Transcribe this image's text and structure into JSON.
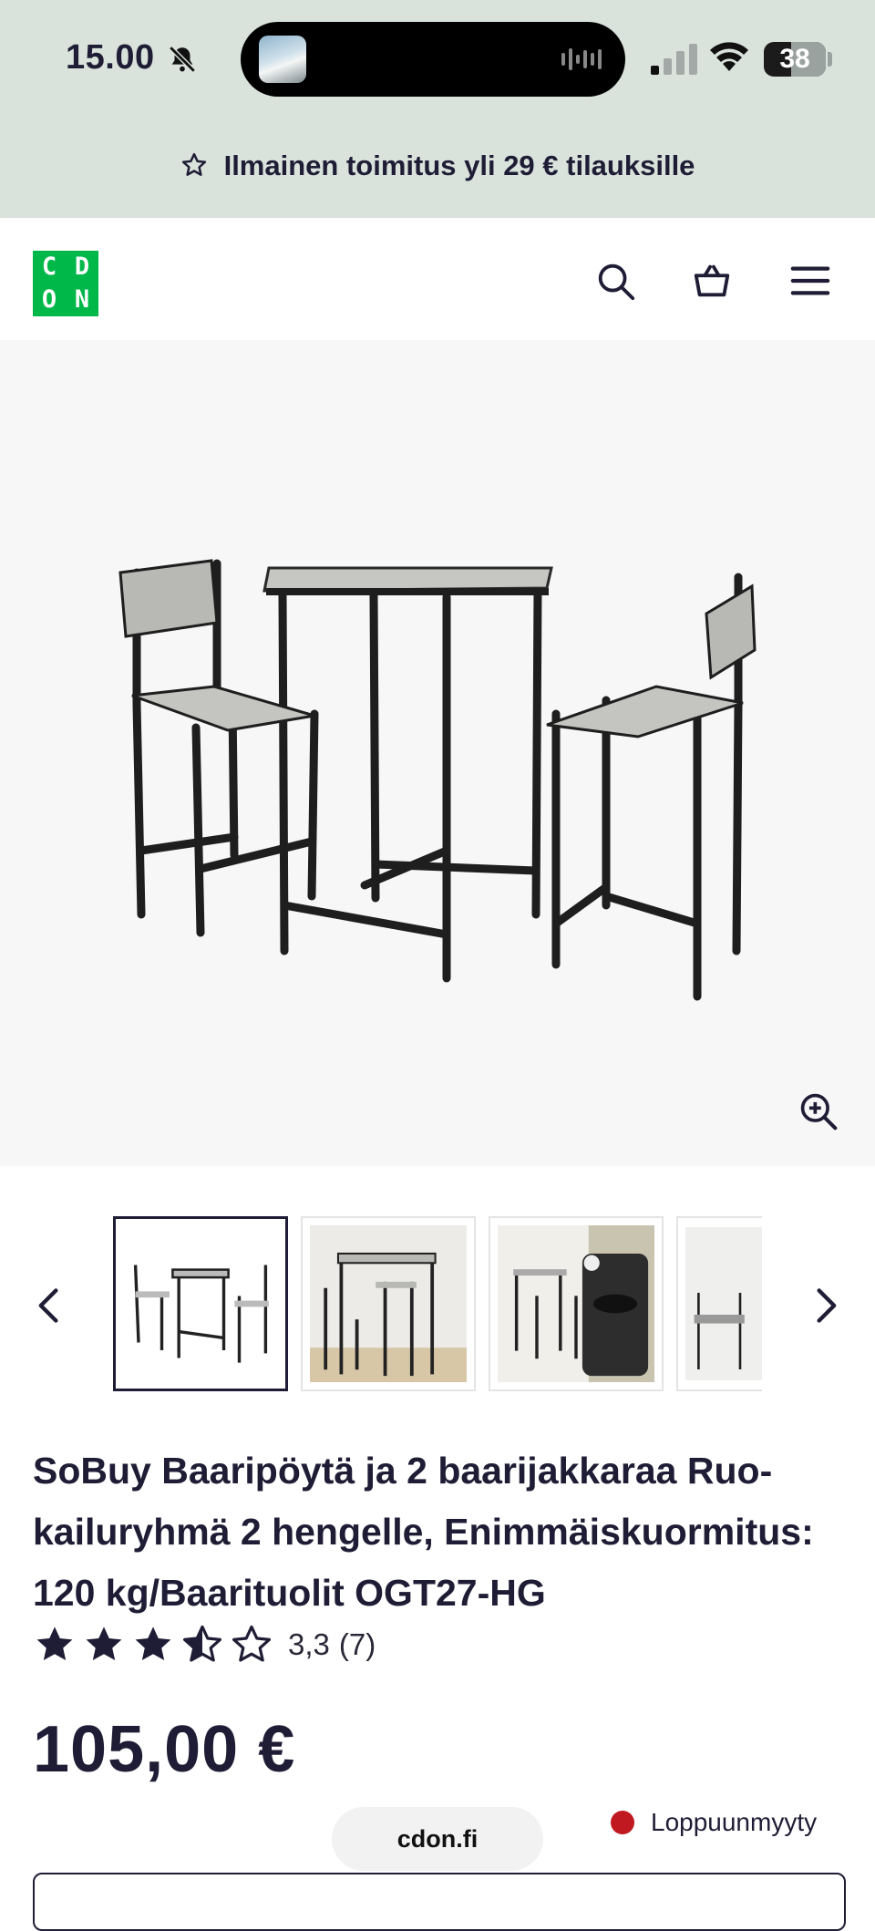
{
  "status_bar": {
    "time": "15.00",
    "battery": "38"
  },
  "promo": {
    "text": "Ilmainen toimitus yli 29 € tilauksille"
  },
  "header": {
    "logo_letters": [
      "C",
      "D",
      "O",
      "N"
    ],
    "icons": [
      "search-icon",
      "basket-icon",
      "menu-icon"
    ]
  },
  "gallery": {
    "zoom_icon": "zoom-in-icon"
  },
  "thumbnails": {
    "count_visible": 4,
    "active_index": 0
  },
  "product": {
    "title": "SoBuy Baaripöytä ja 2 baarijakkaraa Ruo­kailuryhmä 2 hengelle, Enimmäiskuormi­tus: 120 kg/Baarituolit OGT27-HG",
    "rating_value": "3,3",
    "rating_count": "(7)",
    "rating_stars": 3.5,
    "price": "105,00 €",
    "stock_status": "Loppuunmyyty",
    "stock_color": "#c0191f"
  },
  "browser": {
    "url": "cdon.fi"
  },
  "colors": {
    "brand": "#00b74a",
    "text": "#1f1d35",
    "promo_bg": "#d9e3dc"
  }
}
